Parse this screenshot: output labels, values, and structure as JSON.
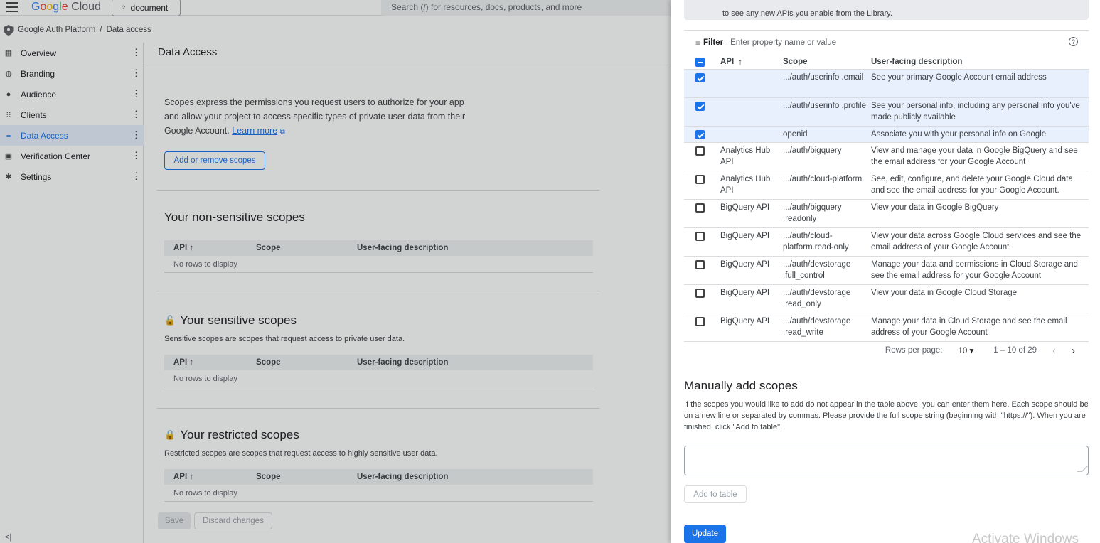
{
  "topbar": {
    "logo_google": [
      "G",
      "o",
      "o",
      "g",
      "l",
      "e"
    ],
    "logo_cloud": "Cloud",
    "project": "document",
    "search_placeholder": "Search (/) for resources, docs, products, and more"
  },
  "breadcrumb": {
    "root": "Google Auth Platform",
    "separator": "/",
    "current": "Data access"
  },
  "sidebar": {
    "items": [
      {
        "label": "Overview",
        "icon": "grid-icon",
        "glyph": "▦"
      },
      {
        "label": "Branding",
        "icon": "palette-icon",
        "glyph": "◍"
      },
      {
        "label": "Audience",
        "icon": "person-icon",
        "glyph": "●"
      },
      {
        "label": "Clients",
        "icon": "apps-icon",
        "glyph": "⁝⁝"
      },
      {
        "label": "Data Access",
        "icon": "data-access-icon",
        "glyph": "≡",
        "active": true
      },
      {
        "label": "Verification Center",
        "icon": "verified-icon",
        "glyph": "▣"
      },
      {
        "label": "Settings",
        "icon": "gear-icon",
        "glyph": "✱"
      }
    ],
    "collapse_glyph": "<|"
  },
  "main": {
    "title": "Data Access",
    "intro": "Scopes express the permissions you request users to authorize for your app and allow your project to access specific types of private user data from their Google Account.",
    "learn_more": "Learn more",
    "add_remove_button": "Add or remove scopes",
    "columns": {
      "api": "API",
      "scope": "Scope",
      "description": "User-facing description"
    },
    "empty": "No rows to display",
    "non_sensitive": {
      "title": "Your non-sensitive scopes"
    },
    "sensitive": {
      "title": "Your sensitive scopes",
      "desc": "Sensitive scopes are scopes that request access to private user data."
    },
    "restricted": {
      "title": "Your restricted scopes",
      "desc": "Restricted scopes are scopes that request access to highly sensitive user data."
    },
    "save": "Save",
    "discard": "Discard changes"
  },
  "panel": {
    "info_line2": "to see any new APIs you enable from the Library.",
    "filter_label": "Filter",
    "filter_placeholder": "Enter property name or value",
    "columns": {
      "api": "API",
      "scope": "Scope",
      "description": "User-facing description"
    },
    "rows": [
      {
        "checked": true,
        "api": "",
        "scope": ".../auth/userinfo .email",
        "description": "See your primary Google Account email address"
      },
      {
        "checked": true,
        "api": "",
        "scope": ".../auth/userinfo .profile",
        "description": "See your personal info, including any personal info you've made publicly available"
      },
      {
        "checked": true,
        "api": "",
        "scope": "openid",
        "description": "Associate you with your personal info on Google"
      },
      {
        "checked": false,
        "api": "Analytics Hub API",
        "scope": ".../auth/bigquery",
        "description": "View and manage your data in Google BigQuery and see the email address for your Google Account"
      },
      {
        "checked": false,
        "api": "Analytics Hub API",
        "scope": ".../auth/cloud-platform",
        "description": "See, edit, configure, and delete your Google Cloud data and see the email address for your Google Account."
      },
      {
        "checked": false,
        "api": "BigQuery API",
        "scope": ".../auth/bigquery .readonly",
        "description": "View your data in Google BigQuery"
      },
      {
        "checked": false,
        "api": "BigQuery API",
        "scope": ".../auth/cloud-platform.read-only",
        "description": "View your data across Google Cloud services and see the email address of your Google Account"
      },
      {
        "checked": false,
        "api": "BigQuery API",
        "scope": ".../auth/devstorage .full_control",
        "description": "Manage your data and permissions in Cloud Storage and see the email address for your Google Account"
      },
      {
        "checked": false,
        "api": "BigQuery API",
        "scope": ".../auth/devstorage .read_only",
        "description": "View your data in Google Cloud Storage"
      },
      {
        "checked": false,
        "api": "BigQuery API",
        "scope": ".../auth/devstorage .read_write",
        "description": "Manage your data in Cloud Storage and see the email address of your Google Account"
      }
    ],
    "pagination": {
      "rows_per_page_label": "Rows per page:",
      "rows_per_page": "10",
      "range": "1 – 10 of 29"
    },
    "manual_title": "Manually add scopes",
    "manual_desc": "If the scopes you would like to add do not appear in the table above, you can enter them here. Each scope should be on a new line or separated by commas. Please provide the full scope string (beginning with \"https://\"). When you are finished, click \"Add to table\".",
    "add_to_table": "Add to table",
    "update": "Update"
  },
  "watermark": "Activate Windows",
  "colors": {
    "accent": "#1a73e8",
    "selected_row": "#e8f0fe",
    "active_nav_bg": "#e8f0fe"
  }
}
